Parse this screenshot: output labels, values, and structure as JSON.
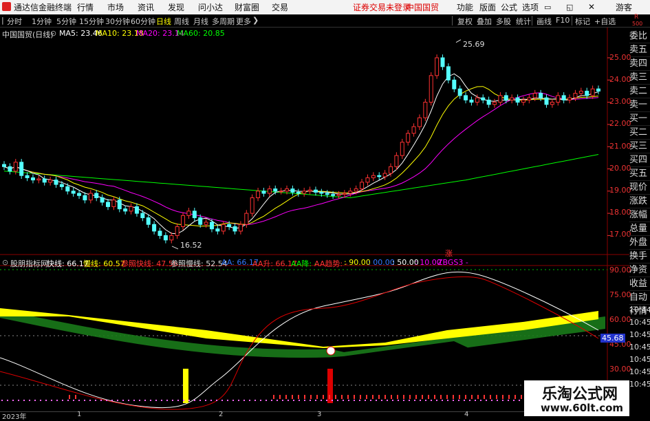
{
  "menubar": {
    "app_title": "通达信金融终端",
    "menus": [
      "行情",
      "市场",
      "资讯",
      "发现",
      "问小达",
      "财富圈",
      "交易"
    ],
    "status": "证券交易未登录",
    "stock": "中国国贸",
    "right": [
      "功能",
      "版面",
      "公式",
      "选项"
    ],
    "user": "游客"
  },
  "toolbar": {
    "periods": [
      "分时",
      "1分钟",
      "5分钟",
      "15分钟",
      "30分钟",
      "60分钟",
      "日线",
      "周线",
      "月线",
      "多周期",
      "更多"
    ],
    "active": "日线",
    "more_icon": "chevron-right-icon",
    "buttons": [
      "复权",
      "叠加",
      "多股",
      "统计",
      "画线",
      "F10",
      "标记",
      "+自选"
    ],
    "rs_top": "R",
    "rs_bottom": "500"
  },
  "main_chart": {
    "title": "中国国贸(日线)",
    "ma5": "MA5: 23.46",
    "ma10": "MA10: 23.18",
    "ma20": "MA20: 23.14",
    "ma60": "MA60: 20.85",
    "high_label": "25.69",
    "low_label": "16.52",
    "rise_mark": "涨",
    "y_ticks": [
      "25.00",
      "24.00",
      "23.00",
      "22.00",
      "21.00",
      "20.00",
      "19.00",
      "18.00",
      "17.00"
    ],
    "colors": {
      "up": "#ff3232",
      "down": "#54ffff",
      "ma5": "#ffffff",
      "ma10": "#ffff00",
      "ma20": "#ff00ff",
      "ma60": "#00ff00"
    }
  },
  "indicator": {
    "name": "股朋指标网",
    "fast": "快线: 66.17",
    "slow": "慢线: 60.57",
    "ref_fast": "参照快线: 47.56",
    "ref_slow": "参照慢线: 52.54",
    "aa": "AA: 66.17",
    "aa_up": "AA升: 66.17",
    "aa_down": "AA降: -",
    "aa_trend": "AA趋势: -",
    "v90": ": 90.00",
    "v00": ": 00.00",
    "v50": ": 50.00",
    "v10": ": 10.00",
    "zbgs": "ZBGS3 -",
    "y_ticks": [
      "90.00",
      "75.00",
      "60.00",
      "45.00",
      "30.00"
    ],
    "current": "45.68",
    "right_col": [
      "10:44",
      "10:45",
      "10:45",
      "10:45",
      "10:45",
      "10:45",
      "10:45"
    ]
  },
  "right_panel": [
    "委比",
    "卖五",
    "卖四",
    "卖三",
    "卖二",
    "卖一",
    "买一",
    "买二",
    "买三",
    "买四",
    "买五",
    "现价",
    "涨跌",
    "涨幅",
    "总量",
    "外盘",
    "换手",
    "净资",
    "收益",
    "自动",
    "行情"
  ],
  "x_axis": [
    "2023年",
    "1",
    "2",
    "3",
    "4"
  ],
  "watermark": {
    "title": "乐淘公式网",
    "url": "www.60lt.com"
  }
}
